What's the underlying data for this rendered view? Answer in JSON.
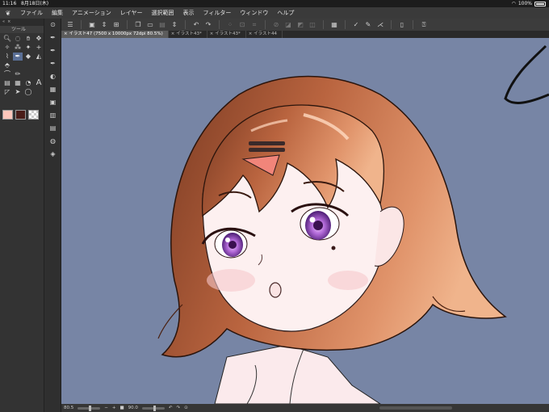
{
  "status": {
    "time": "11:16",
    "date": "8月18日(木)",
    "battery": "100%"
  },
  "menu": [
    "ファイル",
    "編集",
    "アニメーション",
    "レイヤー",
    "選択範囲",
    "表示",
    "フィルター",
    "ウィンドウ",
    "ヘルプ"
  ],
  "toolpanel": {
    "tab_label": "ツール"
  },
  "doc_tabs": [
    {
      "label": "× イラスト47 (7500 x 10000px 72dpi 80.5%)"
    },
    {
      "label": "× イラスト43*"
    },
    {
      "label": "× イラスト43*"
    },
    {
      "label": "× イラスト44"
    }
  ],
  "bottombar": {
    "zoom": "80.5",
    "angle": "90.0"
  },
  "colors": {
    "main": "#ffc7bb",
    "sub": "#4a1d18",
    "canvas_bg": "#7785a5",
    "active_tool": "#5a6f96"
  }
}
